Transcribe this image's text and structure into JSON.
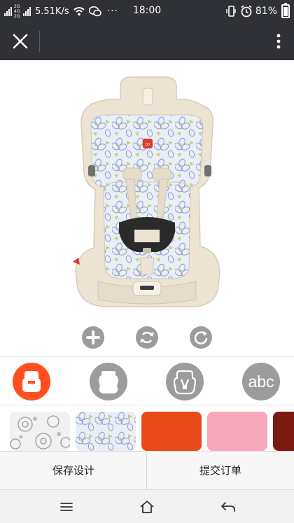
{
  "status_bar": {
    "network_label": "2G 4G 2G",
    "speed": "5.51K/s",
    "dots": "···",
    "time": "18:00",
    "battery": "81%",
    "battery_level": 0.81
  },
  "title_bar": {
    "close_icon": "close-icon",
    "more_icon": "more-vertical-icon"
  },
  "product": {
    "image": "car-seat-image",
    "logo_text": "jo",
    "colors": {
      "shell": "#ece3d3",
      "fabric": "#e9eef6",
      "flower_line": "#8e9dc9",
      "leaf": "#c9cf7a",
      "harness": "#2b2a2a",
      "accent": "#d9392b"
    }
  },
  "actions": [
    {
      "name": "zoom-in",
      "icon": "plus-icon"
    },
    {
      "name": "rotate",
      "icon": "rotate-icon"
    },
    {
      "name": "reset",
      "icon": "refresh-icon"
    }
  ],
  "tabs": [
    {
      "name": "cushion",
      "icon": "cushion-icon",
      "active": true
    },
    {
      "name": "body",
      "icon": "seat-body-icon",
      "active": false
    },
    {
      "name": "backrest",
      "icon": "backrest-icon",
      "active": false
    },
    {
      "name": "text",
      "label": "abc",
      "active": false
    }
  ],
  "swatches": [
    {
      "name": "gray-floral",
      "color": "#c9c9c9"
    },
    {
      "name": "blue-floral",
      "color": "#dde6f3"
    },
    {
      "name": "orange",
      "color": "#e84a1a"
    },
    {
      "name": "pink",
      "color": "#f7a8bb"
    },
    {
      "name": "dark-red",
      "color": "#7c1a12"
    }
  ],
  "action_bar": {
    "save_label": "保存设计",
    "submit_label": "提交订单"
  },
  "system_nav": {
    "menu_icon": "menu-icon",
    "home_icon": "home-icon",
    "back_icon": "back-icon"
  }
}
